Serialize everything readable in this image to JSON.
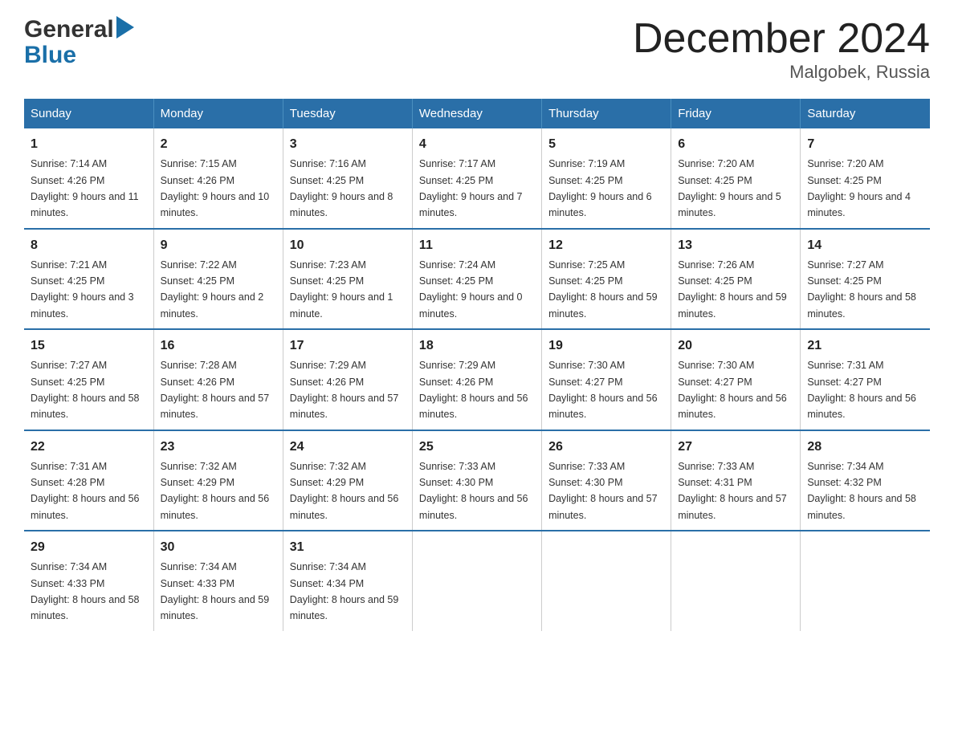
{
  "logo": {
    "line1": "General",
    "triangle": "▶",
    "line2": "Blue"
  },
  "title": "December 2024",
  "subtitle": "Malgobek, Russia",
  "days_header": [
    "Sunday",
    "Monday",
    "Tuesday",
    "Wednesday",
    "Thursday",
    "Friday",
    "Saturday"
  ],
  "weeks": [
    [
      {
        "day": "1",
        "sunrise": "7:14 AM",
        "sunset": "4:26 PM",
        "daylight": "9 hours and 11 minutes."
      },
      {
        "day": "2",
        "sunrise": "7:15 AM",
        "sunset": "4:26 PM",
        "daylight": "9 hours and 10 minutes."
      },
      {
        "day": "3",
        "sunrise": "7:16 AM",
        "sunset": "4:25 PM",
        "daylight": "9 hours and 8 minutes."
      },
      {
        "day": "4",
        "sunrise": "7:17 AM",
        "sunset": "4:25 PM",
        "daylight": "9 hours and 7 minutes."
      },
      {
        "day": "5",
        "sunrise": "7:19 AM",
        "sunset": "4:25 PM",
        "daylight": "9 hours and 6 minutes."
      },
      {
        "day": "6",
        "sunrise": "7:20 AM",
        "sunset": "4:25 PM",
        "daylight": "9 hours and 5 minutes."
      },
      {
        "day": "7",
        "sunrise": "7:20 AM",
        "sunset": "4:25 PM",
        "daylight": "9 hours and 4 minutes."
      }
    ],
    [
      {
        "day": "8",
        "sunrise": "7:21 AM",
        "sunset": "4:25 PM",
        "daylight": "9 hours and 3 minutes."
      },
      {
        "day": "9",
        "sunrise": "7:22 AM",
        "sunset": "4:25 PM",
        "daylight": "9 hours and 2 minutes."
      },
      {
        "day": "10",
        "sunrise": "7:23 AM",
        "sunset": "4:25 PM",
        "daylight": "9 hours and 1 minute."
      },
      {
        "day": "11",
        "sunrise": "7:24 AM",
        "sunset": "4:25 PM",
        "daylight": "9 hours and 0 minutes."
      },
      {
        "day": "12",
        "sunrise": "7:25 AM",
        "sunset": "4:25 PM",
        "daylight": "8 hours and 59 minutes."
      },
      {
        "day": "13",
        "sunrise": "7:26 AM",
        "sunset": "4:25 PM",
        "daylight": "8 hours and 59 minutes."
      },
      {
        "day": "14",
        "sunrise": "7:27 AM",
        "sunset": "4:25 PM",
        "daylight": "8 hours and 58 minutes."
      }
    ],
    [
      {
        "day": "15",
        "sunrise": "7:27 AM",
        "sunset": "4:25 PM",
        "daylight": "8 hours and 58 minutes."
      },
      {
        "day": "16",
        "sunrise": "7:28 AM",
        "sunset": "4:26 PM",
        "daylight": "8 hours and 57 minutes."
      },
      {
        "day": "17",
        "sunrise": "7:29 AM",
        "sunset": "4:26 PM",
        "daylight": "8 hours and 57 minutes."
      },
      {
        "day": "18",
        "sunrise": "7:29 AM",
        "sunset": "4:26 PM",
        "daylight": "8 hours and 56 minutes."
      },
      {
        "day": "19",
        "sunrise": "7:30 AM",
        "sunset": "4:27 PM",
        "daylight": "8 hours and 56 minutes."
      },
      {
        "day": "20",
        "sunrise": "7:30 AM",
        "sunset": "4:27 PM",
        "daylight": "8 hours and 56 minutes."
      },
      {
        "day": "21",
        "sunrise": "7:31 AM",
        "sunset": "4:27 PM",
        "daylight": "8 hours and 56 minutes."
      }
    ],
    [
      {
        "day": "22",
        "sunrise": "7:31 AM",
        "sunset": "4:28 PM",
        "daylight": "8 hours and 56 minutes."
      },
      {
        "day": "23",
        "sunrise": "7:32 AM",
        "sunset": "4:29 PM",
        "daylight": "8 hours and 56 minutes."
      },
      {
        "day": "24",
        "sunrise": "7:32 AM",
        "sunset": "4:29 PM",
        "daylight": "8 hours and 56 minutes."
      },
      {
        "day": "25",
        "sunrise": "7:33 AM",
        "sunset": "4:30 PM",
        "daylight": "8 hours and 56 minutes."
      },
      {
        "day": "26",
        "sunrise": "7:33 AM",
        "sunset": "4:30 PM",
        "daylight": "8 hours and 57 minutes."
      },
      {
        "day": "27",
        "sunrise": "7:33 AM",
        "sunset": "4:31 PM",
        "daylight": "8 hours and 57 minutes."
      },
      {
        "day": "28",
        "sunrise": "7:34 AM",
        "sunset": "4:32 PM",
        "daylight": "8 hours and 58 minutes."
      }
    ],
    [
      {
        "day": "29",
        "sunrise": "7:34 AM",
        "sunset": "4:33 PM",
        "daylight": "8 hours and 58 minutes."
      },
      {
        "day": "30",
        "sunrise": "7:34 AM",
        "sunset": "4:33 PM",
        "daylight": "8 hours and 59 minutes."
      },
      {
        "day": "31",
        "sunrise": "7:34 AM",
        "sunset": "4:34 PM",
        "daylight": "8 hours and 59 minutes."
      },
      {
        "day": "",
        "sunrise": "",
        "sunset": "",
        "daylight": ""
      },
      {
        "day": "",
        "sunrise": "",
        "sunset": "",
        "daylight": ""
      },
      {
        "day": "",
        "sunrise": "",
        "sunset": "",
        "daylight": ""
      },
      {
        "day": "",
        "sunrise": "",
        "sunset": "",
        "daylight": ""
      }
    ]
  ],
  "labels": {
    "sunrise": "Sunrise:",
    "sunset": "Sunset:",
    "daylight": "Daylight:"
  }
}
